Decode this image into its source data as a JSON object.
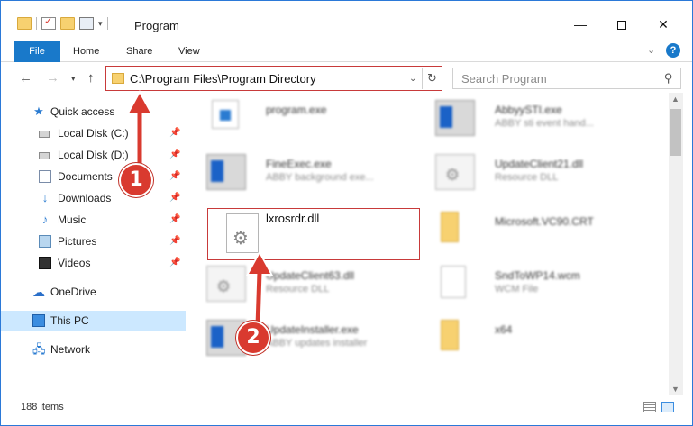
{
  "window": {
    "title": "Program"
  },
  "ribbon": {
    "tabs": [
      "File",
      "Home",
      "Share",
      "View"
    ]
  },
  "address": {
    "path": "C:\\Program Files\\Program Directory"
  },
  "search": {
    "placeholder": "Search Program"
  },
  "sidebar": {
    "items": [
      {
        "label": "Quick access",
        "icon": "star-icon"
      },
      {
        "label": "Local Disk (C:)",
        "icon": "disk-icon",
        "pinned": true
      },
      {
        "label": "Local Disk (D:)",
        "icon": "disk-icon",
        "pinned": true
      },
      {
        "label": "Documents",
        "icon": "documents-icon",
        "pinned": true
      },
      {
        "label": "Downloads",
        "icon": "downloads-icon",
        "pinned": true
      },
      {
        "label": "Music",
        "icon": "music-icon",
        "pinned": true
      },
      {
        "label": "Pictures",
        "icon": "pictures-icon",
        "pinned": true
      },
      {
        "label": "Videos",
        "icon": "videos-icon",
        "pinned": true
      },
      {
        "label": "OneDrive",
        "icon": "onedrive-icon"
      },
      {
        "label": "This PC",
        "icon": "pc-icon",
        "selected": true
      },
      {
        "label": "Network",
        "icon": "network-icon"
      }
    ]
  },
  "files": [
    {
      "name": "program.exe",
      "desc": "",
      "icon": "exe-icon"
    },
    {
      "name": "AbbyySTI.exe",
      "desc": "ABBY sti event hand...",
      "icon": "exe-icon"
    },
    {
      "name": "FineExec.exe",
      "desc": "ABBY background exe...",
      "icon": "exe-icon"
    },
    {
      "name": "UpdateClient21.dll",
      "desc": "Resource DLL",
      "icon": "dll-icon"
    },
    {
      "name": "lxrosrdr.dll",
      "desc": "",
      "icon": "dll-icon"
    },
    {
      "name": "Microsoft.VC90.CRT",
      "desc": "",
      "icon": "folder-icon"
    },
    {
      "name": "UpdateClient63.dll",
      "desc": "Resource DLL",
      "icon": "dll-icon"
    },
    {
      "name": "SndToWP14.wcm",
      "desc": "WCM File",
      "icon": "wcm-icon"
    },
    {
      "name": "UpdateInstaller.exe",
      "desc": "ABBY updates installer",
      "icon": "exe-icon"
    },
    {
      "name": "x64",
      "desc": "",
      "icon": "folder-icon"
    }
  ],
  "status": {
    "item_count": "188 items"
  },
  "callouts": {
    "step1": "1",
    "step2": "2"
  },
  "colors": {
    "accent": "#1979ca",
    "highlight": "#c83a3a",
    "selected_bg": "#cce8ff"
  }
}
